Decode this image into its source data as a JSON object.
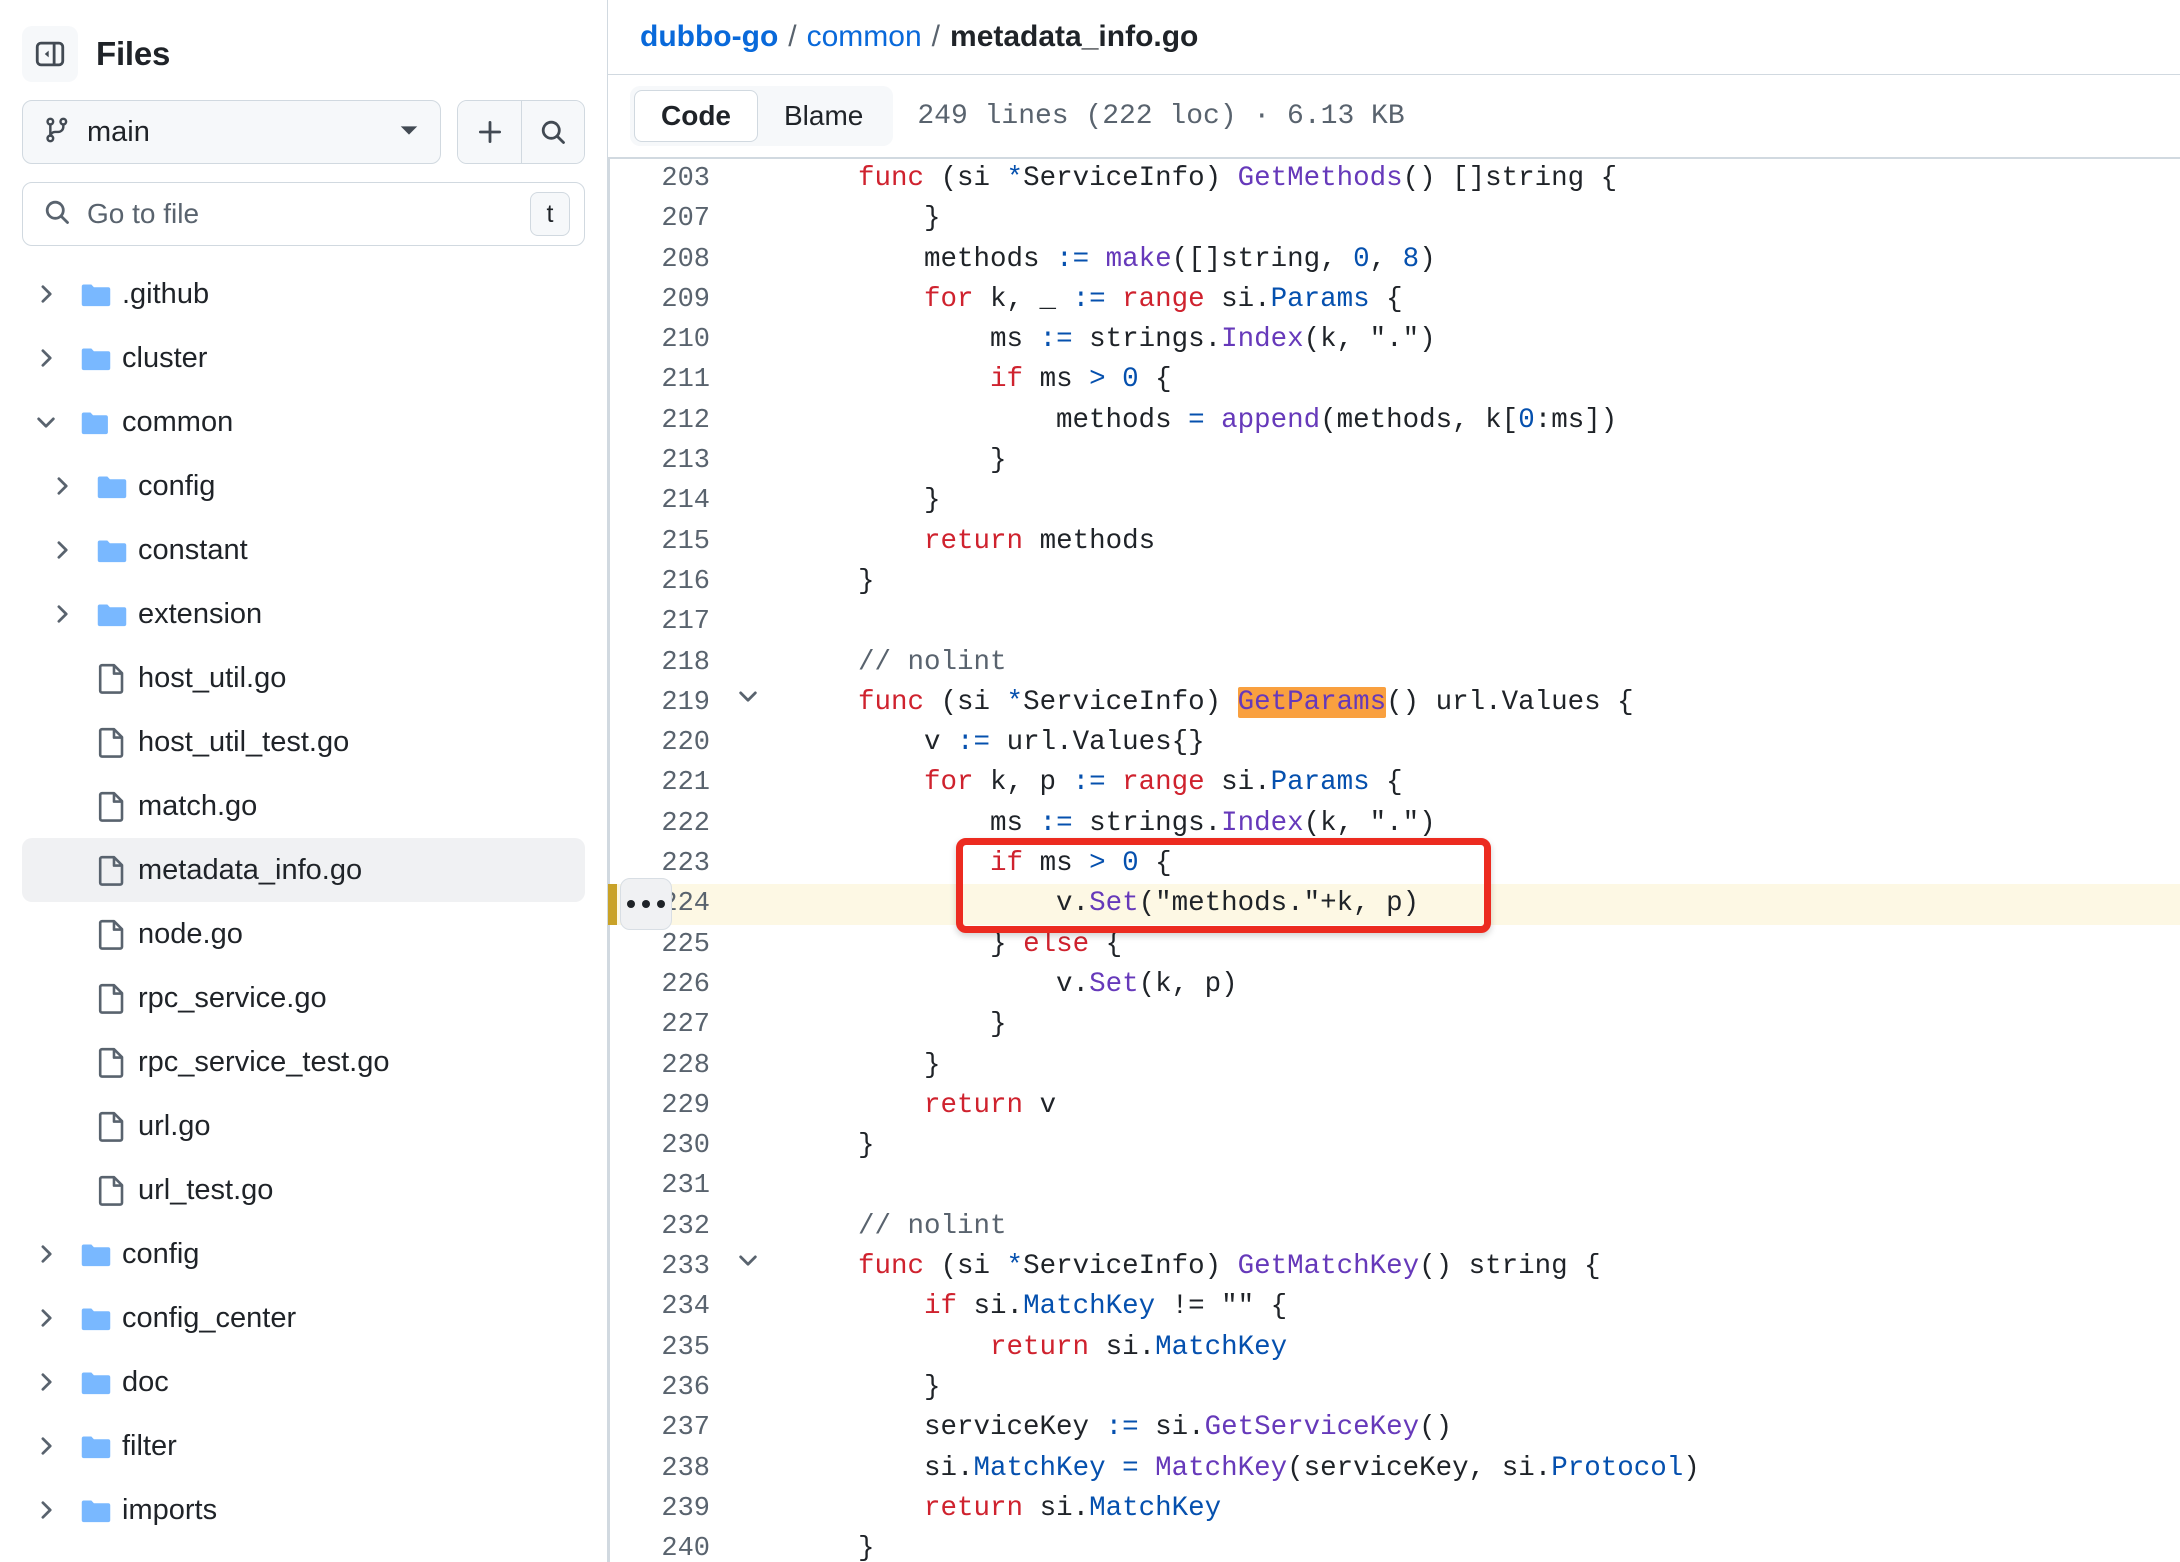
{
  "sidebar": {
    "title": "Files",
    "collapse_icon": "sidebar-collapse-icon",
    "branch": {
      "name": "main",
      "icon": "git-branch-icon",
      "chevron": "chevron-down-icon"
    },
    "actions": [
      {
        "name": "add-file-button",
        "icon": "plus-icon"
      },
      {
        "name": "search-button",
        "icon": "search-icon"
      }
    ],
    "search": {
      "placeholder": "Go to file",
      "icon": "search-icon",
      "shortcut": "t"
    },
    "tree": [
      {
        "label": ".github",
        "type": "folder",
        "depth": 1,
        "expanded": false,
        "selected": false
      },
      {
        "label": "cluster",
        "type": "folder",
        "depth": 1,
        "expanded": false,
        "selected": false
      },
      {
        "label": "common",
        "type": "folder",
        "depth": 1,
        "expanded": true,
        "selected": false
      },
      {
        "label": "config",
        "type": "folder",
        "depth": 2,
        "expanded": false,
        "selected": false
      },
      {
        "label": "constant",
        "type": "folder",
        "depth": 2,
        "expanded": false,
        "selected": false
      },
      {
        "label": "extension",
        "type": "folder",
        "depth": 2,
        "expanded": false,
        "selected": false
      },
      {
        "label": "host_util.go",
        "type": "file",
        "depth": 2,
        "expanded": false,
        "selected": false
      },
      {
        "label": "host_util_test.go",
        "type": "file",
        "depth": 2,
        "expanded": false,
        "selected": false
      },
      {
        "label": "match.go",
        "type": "file",
        "depth": 2,
        "expanded": false,
        "selected": false
      },
      {
        "label": "metadata_info.go",
        "type": "file",
        "depth": 2,
        "expanded": false,
        "selected": true
      },
      {
        "label": "node.go",
        "type": "file",
        "depth": 2,
        "expanded": false,
        "selected": false
      },
      {
        "label": "rpc_service.go",
        "type": "file",
        "depth": 2,
        "expanded": false,
        "selected": false
      },
      {
        "label": "rpc_service_test.go",
        "type": "file",
        "depth": 2,
        "expanded": false,
        "selected": false
      },
      {
        "label": "url.go",
        "type": "file",
        "depth": 2,
        "expanded": false,
        "selected": false
      },
      {
        "label": "url_test.go",
        "type": "file",
        "depth": 2,
        "expanded": false,
        "selected": false
      },
      {
        "label": "config",
        "type": "folder",
        "depth": 1,
        "expanded": false,
        "selected": false
      },
      {
        "label": "config_center",
        "type": "folder",
        "depth": 1,
        "expanded": false,
        "selected": false
      },
      {
        "label": "doc",
        "type": "folder",
        "depth": 1,
        "expanded": false,
        "selected": false
      },
      {
        "label": "filter",
        "type": "folder",
        "depth": 1,
        "expanded": false,
        "selected": false
      },
      {
        "label": "imports",
        "type": "folder",
        "depth": 1,
        "expanded": false,
        "selected": false
      }
    ]
  },
  "breadcrumb": {
    "repo": "dubbo-go",
    "sep1": "/",
    "folder": "common",
    "sep2": "/",
    "file": "metadata_info.go"
  },
  "toolbar": {
    "tab_code": "Code",
    "tab_blame": "Blame",
    "file_meta": "249 lines (222 loc) · 6.13 KB"
  },
  "colors": {
    "link": "#0969da",
    "keyword": "#cf222e",
    "function": "#6639ba",
    "property": "#0550ae",
    "comment": "#59636e",
    "search_highlight": "#f9a03f",
    "line_highlight": "#fdf8e4",
    "annotation_box": "#ec2b20",
    "folder_icon": "#79b8ff",
    "row_marker": "#c9a227"
  },
  "code": {
    "highlighted_line": 224,
    "search_term": "GetParams",
    "lines": [
      {
        "n": "203",
        "fold": "",
        "indent": 1,
        "tokens": [
          {
            "t": "func ",
            "c": "kw"
          },
          {
            "t": "(si ",
            "c": ""
          },
          {
            "t": "*",
            "c": "prop"
          },
          {
            "t": "ServiceInfo) ",
            "c": ""
          },
          {
            "t": "GetMethods",
            "c": "fn"
          },
          {
            "t": "() []string {",
            "c": ""
          }
        ]
      },
      {
        "n": "207",
        "fold": "",
        "indent": 2,
        "tokens": [
          {
            "t": "}",
            "c": ""
          }
        ]
      },
      {
        "n": "208",
        "fold": "",
        "indent": 2,
        "tokens": [
          {
            "t": "methods ",
            "c": ""
          },
          {
            "t": ":=",
            "c": "op"
          },
          {
            "t": " ",
            "c": ""
          },
          {
            "t": "make",
            "c": "fn"
          },
          {
            "t": "([]string, ",
            "c": ""
          },
          {
            "t": "0",
            "c": "num"
          },
          {
            "t": ", ",
            "c": ""
          },
          {
            "t": "8",
            "c": "num"
          },
          {
            "t": ")",
            "c": ""
          }
        ]
      },
      {
        "n": "209",
        "fold": "",
        "indent": 2,
        "tokens": [
          {
            "t": "for",
            "c": "kw"
          },
          {
            "t": " k, _ ",
            "c": ""
          },
          {
            "t": ":=",
            "c": "op"
          },
          {
            "t": " ",
            "c": ""
          },
          {
            "t": "range",
            "c": "kw"
          },
          {
            "t": " si.",
            "c": ""
          },
          {
            "t": "Params",
            "c": "prop"
          },
          {
            "t": " {",
            "c": ""
          }
        ]
      },
      {
        "n": "210",
        "fold": "",
        "indent": 3,
        "tokens": [
          {
            "t": "ms ",
            "c": ""
          },
          {
            "t": ":=",
            "c": "op"
          },
          {
            "t": " strings.",
            "c": ""
          },
          {
            "t": "Index",
            "c": "fn"
          },
          {
            "t": "(k, ",
            "c": ""
          },
          {
            "t": "\".\"",
            "c": "str"
          },
          {
            "t": ")",
            "c": ""
          }
        ]
      },
      {
        "n": "211",
        "fold": "",
        "indent": 3,
        "tokens": [
          {
            "t": "if",
            "c": "kw"
          },
          {
            "t": " ms ",
            "c": ""
          },
          {
            "t": ">",
            "c": "op"
          },
          {
            "t": " ",
            "c": ""
          },
          {
            "t": "0",
            "c": "num"
          },
          {
            "t": " {",
            "c": ""
          }
        ]
      },
      {
        "n": "212",
        "fold": "",
        "indent": 4,
        "tokens": [
          {
            "t": "methods ",
            "c": ""
          },
          {
            "t": "=",
            "c": "op"
          },
          {
            "t": " ",
            "c": ""
          },
          {
            "t": "append",
            "c": "fn"
          },
          {
            "t": "(methods, k[",
            "c": ""
          },
          {
            "t": "0",
            "c": "num"
          },
          {
            "t": ":ms])",
            "c": ""
          }
        ]
      },
      {
        "n": "213",
        "fold": "",
        "indent": 3,
        "tokens": [
          {
            "t": "}",
            "c": ""
          }
        ]
      },
      {
        "n": "214",
        "fold": "",
        "indent": 2,
        "tokens": [
          {
            "t": "}",
            "c": ""
          }
        ]
      },
      {
        "n": "215",
        "fold": "",
        "indent": 2,
        "tokens": [
          {
            "t": "return",
            "c": "kw"
          },
          {
            "t": " methods",
            "c": ""
          }
        ]
      },
      {
        "n": "216",
        "fold": "",
        "indent": 1,
        "tokens": [
          {
            "t": "}",
            "c": ""
          }
        ]
      },
      {
        "n": "217",
        "fold": "",
        "indent": 0,
        "tokens": []
      },
      {
        "n": "218",
        "fold": "",
        "indent": 1,
        "tokens": [
          {
            "t": "// nolint",
            "c": "cmt"
          }
        ]
      },
      {
        "n": "219",
        "fold": "chevron-down-icon",
        "indent": 1,
        "tokens": [
          {
            "t": "func ",
            "c": "kw"
          },
          {
            "t": "(si ",
            "c": ""
          },
          {
            "t": "*",
            "c": "prop"
          },
          {
            "t": "ServiceInfo) ",
            "c": ""
          },
          {
            "t": "GetParams",
            "c": "mark"
          },
          {
            "t": "() url.Values {",
            "c": ""
          }
        ]
      },
      {
        "n": "220",
        "fold": "",
        "indent": 2,
        "tokens": [
          {
            "t": "v ",
            "c": ""
          },
          {
            "t": ":=",
            "c": "op"
          },
          {
            "t": " url.Values{}",
            "c": ""
          }
        ]
      },
      {
        "n": "221",
        "fold": "",
        "indent": 2,
        "tokens": [
          {
            "t": "for",
            "c": "kw"
          },
          {
            "t": " k, p ",
            "c": ""
          },
          {
            "t": ":=",
            "c": "op"
          },
          {
            "t": " ",
            "c": ""
          },
          {
            "t": "range",
            "c": "kw"
          },
          {
            "t": " si.",
            "c": ""
          },
          {
            "t": "Params",
            "c": "prop"
          },
          {
            "t": " {",
            "c": ""
          }
        ]
      },
      {
        "n": "222",
        "fold": "",
        "indent": 3,
        "tokens": [
          {
            "t": "ms ",
            "c": ""
          },
          {
            "t": ":=",
            "c": "op"
          },
          {
            "t": " strings.",
            "c": ""
          },
          {
            "t": "Index",
            "c": "fn"
          },
          {
            "t": "(k, ",
            "c": ""
          },
          {
            "t": "\".\"",
            "c": "str"
          },
          {
            "t": ")",
            "c": ""
          }
        ]
      },
      {
        "n": "223",
        "fold": "",
        "indent": 3,
        "tokens": [
          {
            "t": "if",
            "c": "kw"
          },
          {
            "t": " ms ",
            "c": ""
          },
          {
            "t": ">",
            "c": "op"
          },
          {
            "t": " ",
            "c": ""
          },
          {
            "t": "0",
            "c": "num"
          },
          {
            "t": " {",
            "c": ""
          }
        ]
      },
      {
        "n": "224",
        "fold": "",
        "indent": 4,
        "tokens": [
          {
            "t": "v.",
            "c": ""
          },
          {
            "t": "Set",
            "c": "fn"
          },
          {
            "t": "(",
            "c": ""
          },
          {
            "t": "\"methods.\"",
            "c": "str"
          },
          {
            "t": "+k, p)",
            "c": ""
          }
        ]
      },
      {
        "n": "225",
        "fold": "",
        "indent": 3,
        "tokens": [
          {
            "t": "} ",
            "c": ""
          },
          {
            "t": "else",
            "c": "kw"
          },
          {
            "t": " {",
            "c": ""
          }
        ]
      },
      {
        "n": "226",
        "fold": "",
        "indent": 4,
        "tokens": [
          {
            "t": "v.",
            "c": ""
          },
          {
            "t": "Set",
            "c": "fn"
          },
          {
            "t": "(k, p)",
            "c": ""
          }
        ]
      },
      {
        "n": "227",
        "fold": "",
        "indent": 3,
        "tokens": [
          {
            "t": "}",
            "c": ""
          }
        ]
      },
      {
        "n": "228",
        "fold": "",
        "indent": 2,
        "tokens": [
          {
            "t": "}",
            "c": ""
          }
        ]
      },
      {
        "n": "229",
        "fold": "",
        "indent": 2,
        "tokens": [
          {
            "t": "return",
            "c": "kw"
          },
          {
            "t": " v",
            "c": ""
          }
        ]
      },
      {
        "n": "230",
        "fold": "",
        "indent": 1,
        "tokens": [
          {
            "t": "}",
            "c": ""
          }
        ]
      },
      {
        "n": "231",
        "fold": "",
        "indent": 0,
        "tokens": []
      },
      {
        "n": "232",
        "fold": "",
        "indent": 1,
        "tokens": [
          {
            "t": "// nolint",
            "c": "cmt"
          }
        ]
      },
      {
        "n": "233",
        "fold": "chevron-down-icon",
        "indent": 1,
        "tokens": [
          {
            "t": "func ",
            "c": "kw"
          },
          {
            "t": "(si ",
            "c": ""
          },
          {
            "t": "*",
            "c": "prop"
          },
          {
            "t": "ServiceInfo) ",
            "c": ""
          },
          {
            "t": "GetMatchKey",
            "c": "fn"
          },
          {
            "t": "() string {",
            "c": ""
          }
        ]
      },
      {
        "n": "234",
        "fold": "",
        "indent": 2,
        "tokens": [
          {
            "t": "if",
            "c": "kw"
          },
          {
            "t": " si.",
            "c": ""
          },
          {
            "t": "MatchKey",
            "c": "prop"
          },
          {
            "t": " != ",
            "c": ""
          },
          {
            "t": "\"\"",
            "c": "str"
          },
          {
            "t": " {",
            "c": ""
          }
        ]
      },
      {
        "n": "235",
        "fold": "",
        "indent": 3,
        "tokens": [
          {
            "t": "return",
            "c": "kw"
          },
          {
            "t": " si.",
            "c": ""
          },
          {
            "t": "MatchKey",
            "c": "prop"
          }
        ]
      },
      {
        "n": "236",
        "fold": "",
        "indent": 2,
        "tokens": [
          {
            "t": "}",
            "c": ""
          }
        ]
      },
      {
        "n": "237",
        "fold": "",
        "indent": 2,
        "tokens": [
          {
            "t": "serviceKey ",
            "c": ""
          },
          {
            "t": ":=",
            "c": "op"
          },
          {
            "t": " si.",
            "c": ""
          },
          {
            "t": "GetServiceKey",
            "c": "fn"
          },
          {
            "t": "()",
            "c": ""
          }
        ]
      },
      {
        "n": "238",
        "fold": "",
        "indent": 2,
        "tokens": [
          {
            "t": "si.",
            "c": ""
          },
          {
            "t": "MatchKey",
            "c": "prop"
          },
          {
            "t": " ",
            "c": ""
          },
          {
            "t": "=",
            "c": "op"
          },
          {
            "t": " ",
            "c": ""
          },
          {
            "t": "MatchKey",
            "c": "fn"
          },
          {
            "t": "(serviceKey, si.",
            "c": ""
          },
          {
            "t": "Protocol",
            "c": "prop"
          },
          {
            "t": ")",
            "c": ""
          }
        ]
      },
      {
        "n": "239",
        "fold": "",
        "indent": 2,
        "tokens": [
          {
            "t": "return",
            "c": "kw"
          },
          {
            "t": " si.",
            "c": ""
          },
          {
            "t": "MatchKey",
            "c": "prop"
          }
        ]
      },
      {
        "n": "240",
        "fold": "",
        "indent": 1,
        "tokens": [
          {
            "t": "}",
            "c": ""
          }
        ]
      }
    ]
  }
}
